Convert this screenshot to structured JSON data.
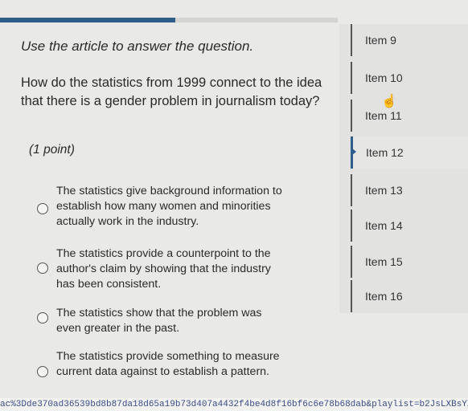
{
  "progress": {
    "fraction": 0.52
  },
  "prompt": "Use the article to answer the question.",
  "question": "How do the statistics from 1999 connect to the idea that there is a gender problem in journalism today?",
  "points": "(1 point)",
  "choices": [
    "The statistics give background information to establish how many women and minorities actually work in the industry.",
    "The statistics provide a counterpoint to the author's claim by showing that the industry has been consistent.",
    "The statistics show that the problem was even greater in the past.",
    "The statistics provide something to measure current data against to establish a pattern."
  ],
  "items": [
    "Item 9",
    "Item 10",
    "Item 11",
    "Item 12",
    "Item 13",
    "Item 14",
    "Item 15",
    "Item 16"
  ],
  "current_item_index": 3,
  "cursor_icon": "hand-pointer-icon",
  "status_url": "ac%3Dde370ad36539bd8b87da18d65a19b73d407a4432f4be4d8f16bf6c6e78b68dab&playlist=b2JsLXBsYXlsaXN0cy85ZjQ="
}
